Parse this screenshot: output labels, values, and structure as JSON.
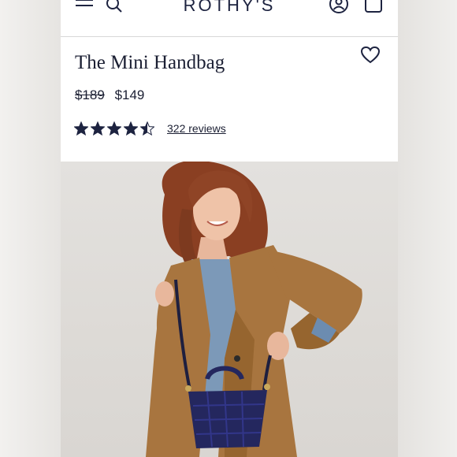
{
  "header": {
    "logo": "ROTHY'S",
    "icons": [
      "menu-icon",
      "search-icon",
      "account-icon",
      "bag-icon"
    ]
  },
  "product": {
    "name": "The Mini Handbag",
    "price_original": "$189",
    "price_sale": "$149",
    "rating": 4.5,
    "rating_max": 5,
    "reviews_label": "322 reviews"
  },
  "colors": {
    "brand": "#1d2340",
    "text": "#1b1f33",
    "coat": "#a8753f",
    "bag": "#24275e",
    "shirt": "#7c99b8",
    "hair": "#8a3f22"
  }
}
